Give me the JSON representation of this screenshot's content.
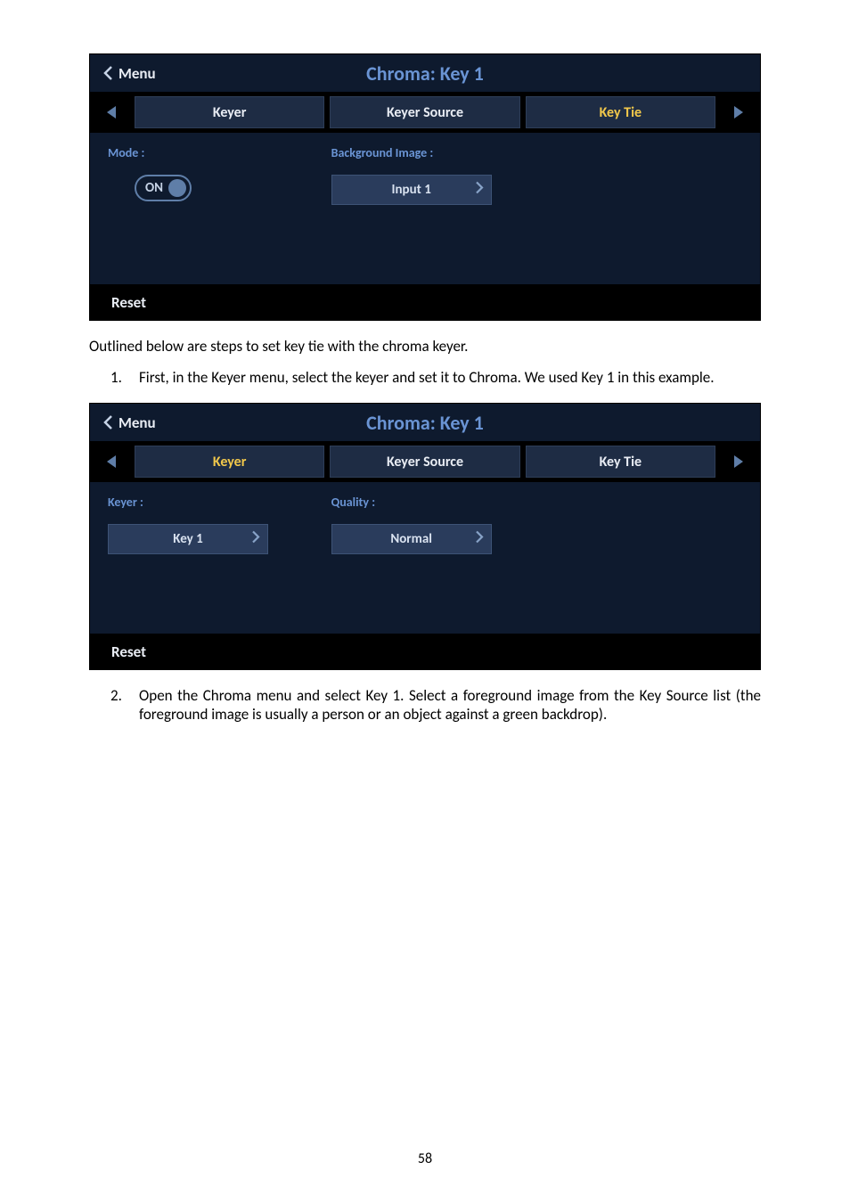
{
  "panel1": {
    "back": "Menu",
    "title": "Chroma: Key 1",
    "tabs": [
      "Keyer",
      "Keyer Source",
      "Key Tie"
    ],
    "activeTab": "Key Tie",
    "mode_label": "Mode :",
    "toggle_text": "ON",
    "bg_label": "Background Image :",
    "bg_value": "Input 1",
    "reset": "Reset"
  },
  "doc": {
    "intro": "Outlined below are steps to set key tie with the chroma keyer.",
    "step1_num": "1.",
    "step1": "First, in the Keyer menu, select the keyer and set it to Chroma. We used Key 1 in this example.",
    "step2_num": "2.",
    "step2": "Open the Chroma menu and select Key 1. Select a foreground image from the Key Source list (the foreground image is usually a person or an object against a green backdrop).",
    "page_number": "58"
  },
  "panel2": {
    "back": "Menu",
    "title": "Chroma: Key 1",
    "tabs": [
      "Keyer",
      "Keyer Source",
      "Key Tie"
    ],
    "activeTab": "Keyer",
    "keyer_label": "Keyer :",
    "keyer_value": "Key 1",
    "quality_label": "Quality :",
    "quality_value": "Normal",
    "reset": "Reset"
  }
}
